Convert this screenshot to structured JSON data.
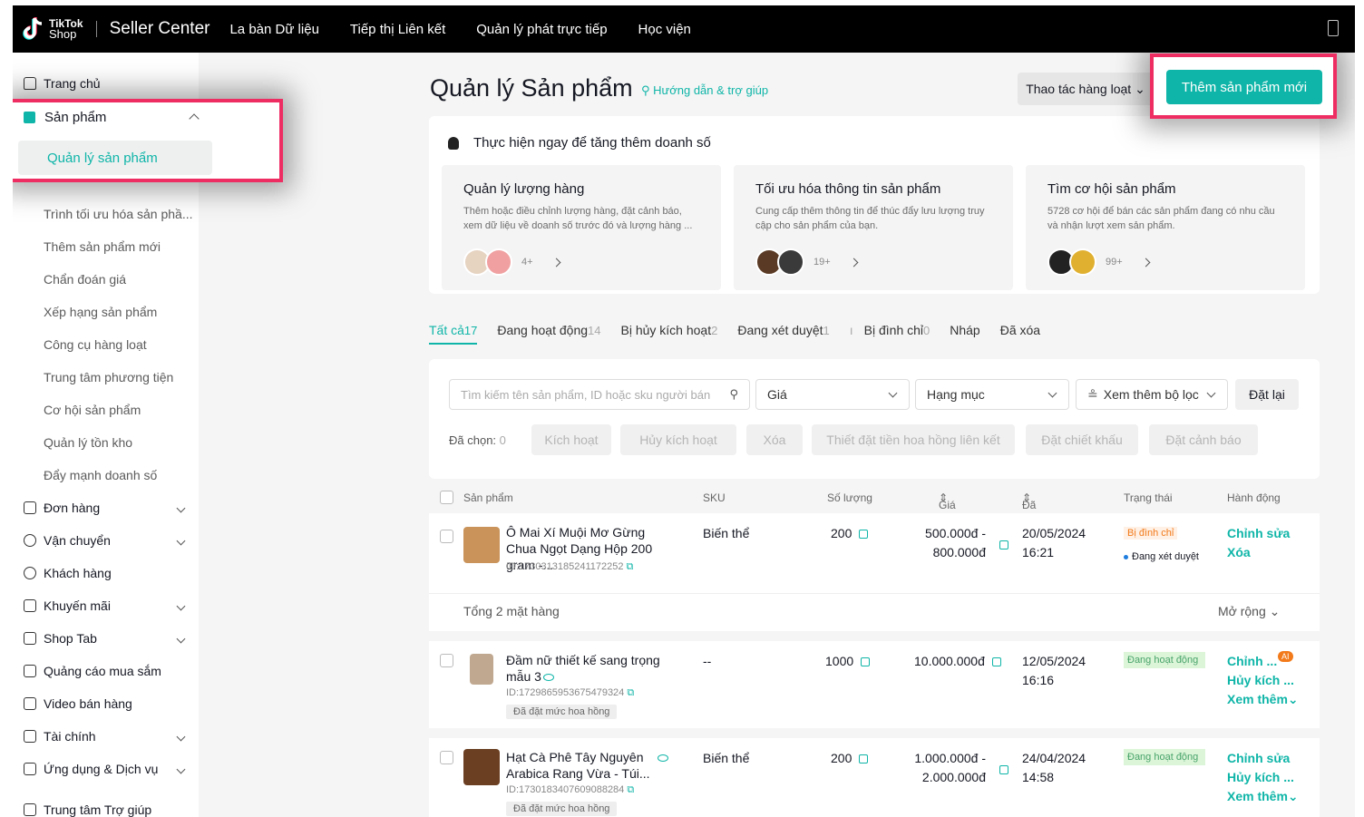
{
  "topbar": {
    "logo_line1": "TikTok",
    "logo_line2": "Shop",
    "brand": "Seller Center",
    "nav": [
      "La bàn Dữ liệu",
      "Tiếp thị Liên kết",
      "Quản lý phát trực tiếp",
      "Học viện"
    ]
  },
  "sidebar": {
    "home": "Trang chủ",
    "products": "Sản phẩm",
    "product_manage": "Quản lý sản phẩm",
    "sub_items": [
      "Trình tối ưu hóa sản phầ...",
      "Thêm sản phẩm mới",
      "Chẩn đoán giá",
      "Xếp hạng sản phẩm",
      "Công cụ hàng loạt",
      "Trung tâm phương tiện",
      "Cơ hội sản phẩm",
      "Quản lý tồn kho",
      "Đẩy mạnh doanh số"
    ],
    "sections": [
      "Đơn hàng",
      "Vận chuyển",
      "Khách hàng",
      "Khuyến mãi",
      "Shop Tab",
      "Quảng cáo mua sắm",
      "Video bán hàng",
      "Tài chính",
      "Ứng dụng & Dịch vụ",
      "Trung tâm Trợ giúp"
    ]
  },
  "header": {
    "title": "Quản lý Sản phẩm",
    "help": "Hướng dẫn & trợ giúp",
    "bulk": "Thao tác hàng loạt",
    "add_product": "Thêm sản phẩm mới"
  },
  "tips": {
    "title": "Thực hiện ngay để tăng thêm doanh số",
    "cards": [
      {
        "title": "Quản lý lượng hàng",
        "desc": "Thêm hoặc điều chỉnh lượng hàng, đặt cảnh báo, xem dữ liệu về doanh số trước đó và lượng hàng ...",
        "count": "4+"
      },
      {
        "title": "Tối ưu hóa thông tin sản phẩm",
        "desc": "Cung cấp thêm thông tin để thúc đẩy lưu lượng truy cập cho sản phẩm của bạn.",
        "count": "19+"
      },
      {
        "title": "Tìm cơ hội sản phẩm",
        "desc": "5728 cơ hội để bán các sản phẩm đang có nhu cầu và nhận lượt xem sản phẩm.",
        "count": "99+"
      }
    ]
  },
  "tabs": [
    {
      "label": "Tất cả",
      "count": "17"
    },
    {
      "label": "Đang hoạt động",
      "count": "14"
    },
    {
      "label": "Bị hủy kích hoạt",
      "count": "2"
    },
    {
      "label": "Đang xét duyệt",
      "count": "1"
    },
    {
      "label": "Bị đình chỉ",
      "count": "0"
    },
    {
      "label": "Nháp",
      "count": ""
    },
    {
      "label": "Đã xóa",
      "count": ""
    }
  ],
  "filters": {
    "search_placeholder": "Tìm kiếm tên sản phẩm, ID hoặc sku người bán",
    "price": "Giá",
    "category": "Hạng mục",
    "more": "Xem thêm bộ lọc",
    "reset": "Đặt lại",
    "selected": "Đã chọn: ",
    "selected_count": "0",
    "bulk_actions": [
      "Kích hoạt",
      "Hủy kích hoạt",
      "Xóa",
      "Thiết đặt tiền hoa hồng liên kết",
      "Đặt chiết khấu",
      "Đặt cảnh báo"
    ]
  },
  "table": {
    "headers": [
      "Sản phẩm",
      "SKU",
      "Số lượng",
      "Giá bán lẻ",
      "Đã cập nhật",
      "Trạng thái",
      "Hành động"
    ],
    "group_total": "Tổng 2 mặt hàng",
    "expand": "Mở rộng",
    "rows": [
      {
        "name": "Ô Mai Xí Muội Mơ Gừng Chua Ngọt Dạng Hộp 200 gram -...",
        "id": "ID:1730313185241172252",
        "sku": "Biến thể",
        "qty": "200",
        "price": "500.000đ -\n800.000đ",
        "updated": "20/05/2024\n16:21",
        "status1": "Bị đình chỉ",
        "status2": "Đang xét duyệt",
        "actions": [
          "Chỉnh sửa",
          "Xóa"
        ]
      },
      {
        "name": "Đầm nữ thiết kế sang trọng mẫu 3",
        "id": "ID:1729865953675479324",
        "tag": "Đã đặt mức hoa hồng",
        "sku": "--",
        "qty": "1000",
        "price": "10.000.000đ",
        "updated": "12/05/2024\n16:16",
        "status1": "Đang hoạt động",
        "actions": [
          "Chỉnh ...",
          "Hủy kích ...",
          "Xem thêm"
        ],
        "ai": "AI"
      },
      {
        "name": "Hạt Cà Phê Tây Nguyên Arabica Rang Vừa - Túi...",
        "id": "ID:1730183407609088284",
        "tag": "Đã đặt mức hoa hồng",
        "sku": "Biến thể",
        "qty": "200",
        "price": "1.000.000đ -\n2.000.000đ",
        "updated": "24/04/2024\n14:58",
        "status1": "Đang hoạt động",
        "actions": [
          "Chỉnh sửa",
          "Hủy kích ...",
          "Xem thêm"
        ]
      }
    ]
  },
  "colors": {
    "accent": "#0fb5a8",
    "highlight": "#ee2d63"
  }
}
